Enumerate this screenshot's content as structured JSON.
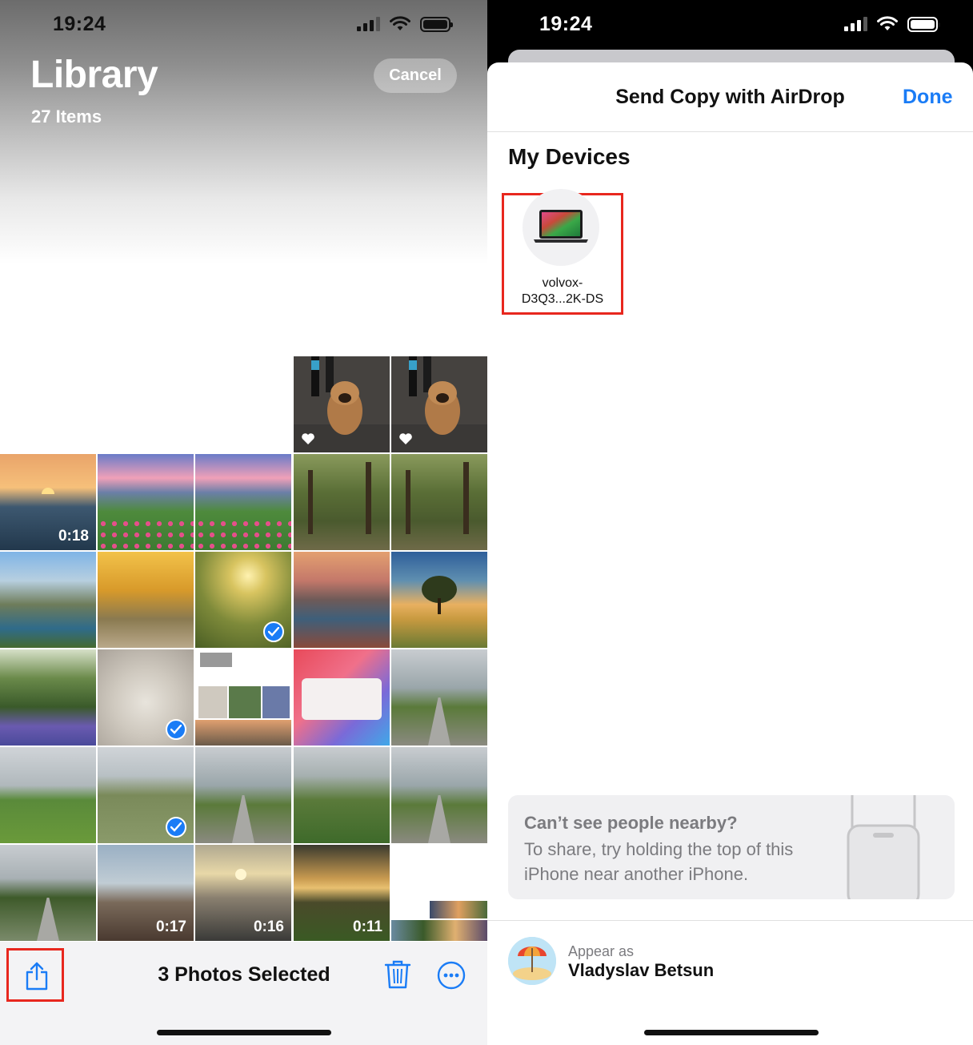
{
  "left_screen": {
    "status": {
      "time": "19:24"
    },
    "header": {
      "title": "Library",
      "count": "27 Items",
      "cancel_label": "Cancel"
    },
    "grid": {
      "thumbnails": [
        {
          "scene": "dog",
          "favorite": true
        },
        {
          "scene": "dog",
          "favorite": true
        },
        {
          "scene": "sea-sunset",
          "duration": "0:18"
        },
        {
          "scene": "mountain-flowers"
        },
        {
          "scene": "mountain-flowers"
        },
        {
          "scene": "forest-path"
        },
        {
          "scene": "forest-path"
        },
        {
          "scene": "mountain-river"
        },
        {
          "scene": "autumn-road"
        },
        {
          "scene": "sunbeam-forest",
          "selected": true
        },
        {
          "scene": "lake-sunset"
        },
        {
          "scene": "tree-field"
        },
        {
          "scene": "bluebell-forest"
        },
        {
          "scene": "sleeping-dog",
          "selected": true
        },
        {
          "scene": "photos-screenshot"
        },
        {
          "scene": "trust-dialog-screenshot"
        },
        {
          "scene": "country-road"
        },
        {
          "scene": "green-field"
        },
        {
          "scene": "country-lane",
          "selected": true
        },
        {
          "scene": "country-road"
        },
        {
          "scene": "meadow"
        },
        {
          "scene": "country-road"
        },
        {
          "scene": "road-trees"
        },
        {
          "scene": "jetty",
          "duration": "0:17"
        },
        {
          "scene": "lake-sun",
          "duration": "0:16"
        },
        {
          "scene": "pine-sunset",
          "duration": "0:11"
        },
        {
          "scene": "collage"
        }
      ]
    },
    "toolbar": {
      "selected_label": "3 Photos Selected",
      "share_icon": "share-icon",
      "trash_icon": "trash-icon",
      "more_icon": "more-icon"
    }
  },
  "right_screen": {
    "status": {
      "time": "19:24"
    },
    "sheet": {
      "title": "Send Copy with AirDrop",
      "done_label": "Done",
      "devices_heading": "My Devices",
      "device": {
        "name_line1": "volvox-",
        "name_line2": "D3Q3...2K-DS",
        "icon": "laptop-icon"
      },
      "hint": {
        "title": "Can’t see people nearby?",
        "body": "To share, try holding the top of this iPhone near another iPhone."
      },
      "appear_as": {
        "label": "Appear as",
        "name": "Vladyslav Betsun",
        "icon": "beach-avatar-icon"
      }
    }
  },
  "colors": {
    "accent": "#1a7cf6",
    "highlight": "#e8271e"
  }
}
